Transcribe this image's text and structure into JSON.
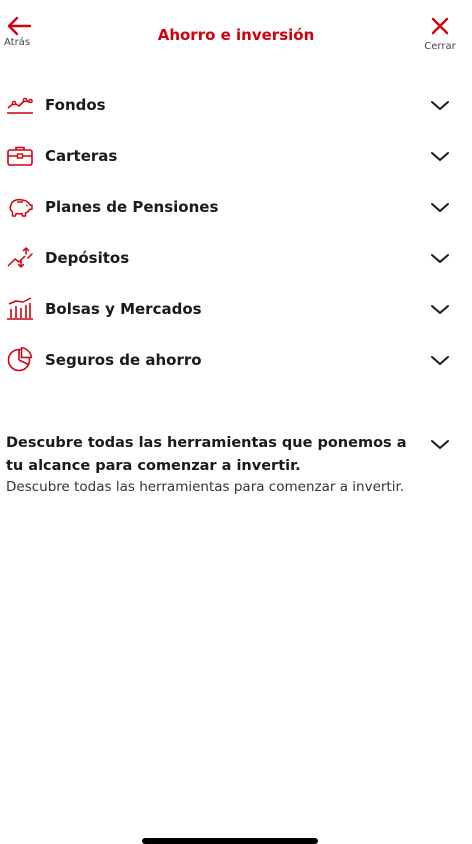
{
  "header": {
    "title": "Ahorro e inversión",
    "back_label": "Atrás",
    "close_label": "Cerrar"
  },
  "menu": {
    "items": [
      {
        "label": "Fondos",
        "icon": "line-chart-icon"
      },
      {
        "label": "Carteras",
        "icon": "briefcase-icon"
      },
      {
        "label": "Planes de Pensiones",
        "icon": "piggy-bank-icon"
      },
      {
        "label": "Depósitos",
        "icon": "trend-arrows-icon"
      },
      {
        "label": "Bolsas y Mercados",
        "icon": "stock-market-icon"
      },
      {
        "label": "Seguros de ahorro",
        "icon": "pie-chart-icon"
      }
    ]
  },
  "discover": {
    "title": "Descubre todas las herramientas que ponemos a tu alcance para comenzar a invertir.",
    "description": "Descubre todas las herramientas para comenzar a invertir."
  },
  "colors": {
    "accent": "#d0000f",
    "text": "#1a1a1a"
  }
}
